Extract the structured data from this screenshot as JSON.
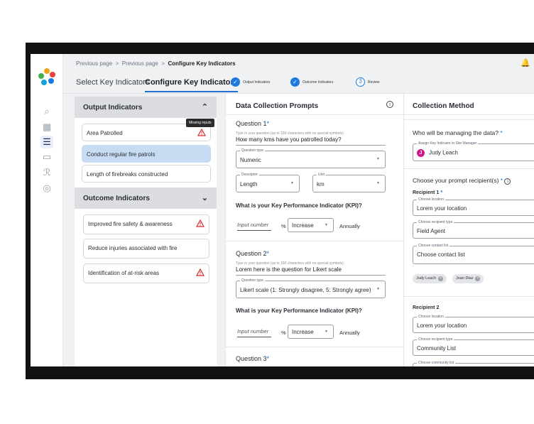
{
  "breadcrumb": {
    "p1": "Previous page",
    "sep1": ">",
    "p2": "Previous page",
    "sep2": ">",
    "current": "Configure Key Indicators"
  },
  "tabs": {
    "select": "Select Key Indicators",
    "configure": "Configure Key Indicators"
  },
  "stepper": [
    {
      "label": "Output Indicators"
    },
    {
      "label": "Outcome Indicators"
    },
    {
      "label": "Review",
      "num": "3"
    }
  ],
  "output": {
    "title": "Output Indicators",
    "items": [
      {
        "label": "Area Patrolled"
      },
      {
        "label": "Conduct regular fire patrols"
      },
      {
        "label": "Length of firebreaks constructed"
      }
    ],
    "tooltip": "Missing inputs"
  },
  "outcome": {
    "title": "Outcome Indicators",
    "items": [
      {
        "label": "Improved fire safety & awareness"
      },
      {
        "label": "Reduce injuries associated with fire"
      },
      {
        "label": "Identification of at-risk areas"
      }
    ]
  },
  "prompts": {
    "title": "Data Collection Prompts",
    "info": "i",
    "questions": [
      {
        "title": "Question 1",
        "hint": "Type in your question (up to 160 characters with no special symbols)",
        "text": "How many kms have you patrolled today?",
        "type_label": "Question type",
        "type_value": "Numeric",
        "desc_label": "Descriptor",
        "desc_value": "Length",
        "unit_label": "Unit",
        "unit_value": "km",
        "kpi_title": "What is your Key Performance Indicator (KPI)?",
        "kpi_placeholder": "Input number",
        "kpi_pct": "%",
        "kpi_dir": "Increase",
        "kpi_freq": "Annually"
      },
      {
        "title": "Question 2",
        "hint": "Type in your question (up to 160 characters with no special symbols)",
        "text": "Lorem here is the question for Likert scale",
        "type_label": "Question type",
        "type_value": "Likert scale (1: Strongly disagree, 5: Strongly agree)",
        "kpi_title": "What is your Key Performance Indicator (KPI)?",
        "kpi_placeholder": "Input number",
        "kpi_pct": "%",
        "kpi_dir": "Increase",
        "kpi_freq": "Annually"
      },
      {
        "title": "Question 3"
      }
    ],
    "required": "*"
  },
  "collection": {
    "title": "Collection Method",
    "manage_q": "Who will be managing the data?",
    "manager_label": "Assign Key Indicator to Site Manager",
    "manager_initial": "J",
    "manager_name": "Judy Leach",
    "recip_q": "Choose your prompt recipient(s)",
    "recipient1": {
      "title": "Recipient 1",
      "loc_label": "Choose location",
      "loc_value": "Lorem your location",
      "type_label": "Choose recipient type",
      "type_value": "Field Agent",
      "contact_label": "Choose contact list",
      "contact_value": "Choose contact list",
      "chips": [
        "Judy Leach",
        "Jean Diaz"
      ]
    },
    "recipient2": {
      "title": "Recipient 2",
      "loc_label": "Choose location",
      "loc_value": "Lorem your location",
      "type_label": "Choose recipient type",
      "type_value": "Community List",
      "community_label": "Choose community list"
    }
  },
  "colors": {
    "accent": "#1f7ae0",
    "selected": "#c7dcf3",
    "warning": "#d62828",
    "avatar": "#d0168f"
  }
}
